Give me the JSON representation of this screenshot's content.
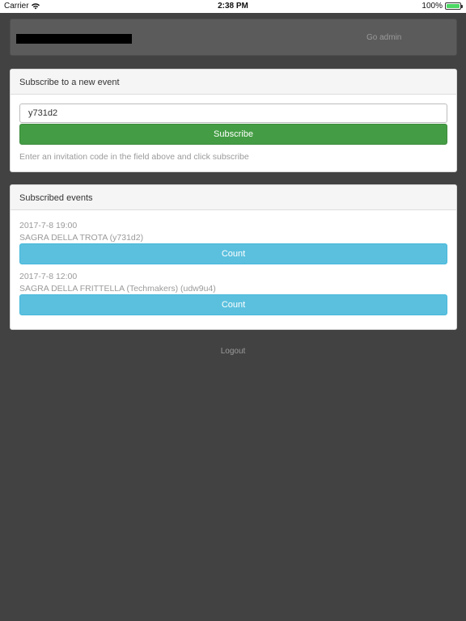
{
  "statusbar": {
    "carrier": "Carrier",
    "time": "2:38 PM",
    "battery": "100%",
    "battery_level": 1.0,
    "battery_color": "#4cd964"
  },
  "topbar": {
    "go_admin_label": "Go admin"
  },
  "subscribe_panel": {
    "title": "Subscribe to a new event",
    "code_value": "y731d2",
    "button_label": "Subscribe",
    "help": "Enter an invitation code in the field above and click subscribe"
  },
  "events_panel": {
    "title": "Subscribed events",
    "events": [
      {
        "date": "2017-7-8 19:00",
        "name": "SAGRA DELLA TROTA (y731d2)",
        "button_label": "Count"
      },
      {
        "date": "2017-7-8 12:00",
        "name": "SAGRA DELLA FRITTELLA (Techmakers) (udw9u4)",
        "button_label": "Count"
      }
    ]
  },
  "footer": {
    "logout_label": "Logout"
  },
  "colors": {
    "background": "#424242",
    "success": "#449d44",
    "info": "#5bc0de"
  }
}
